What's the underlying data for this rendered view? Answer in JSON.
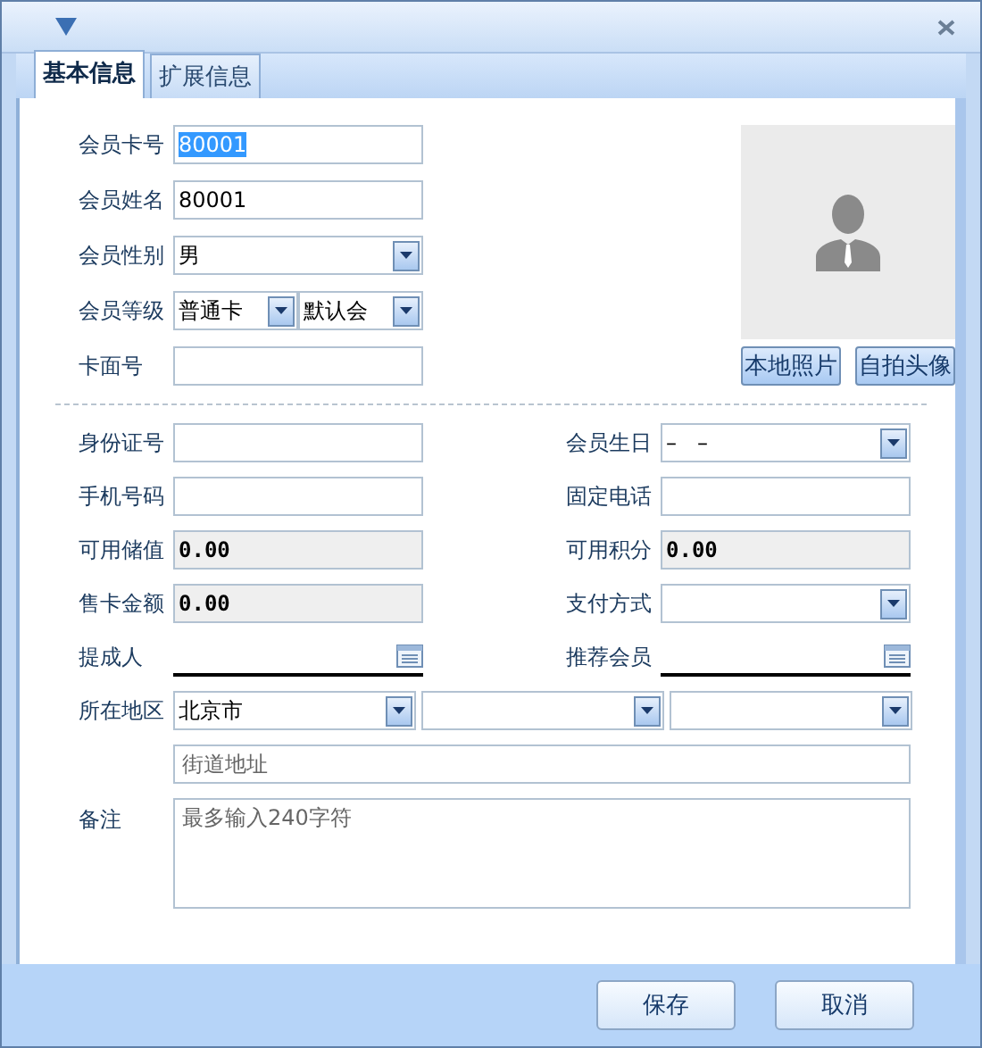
{
  "tabs": [
    {
      "label": "基本信息",
      "selected": true
    },
    {
      "label": "扩展信息",
      "selected": false
    }
  ],
  "top_fields": [
    {
      "label": "会员卡号",
      "kind": "text",
      "value": "80001",
      "highlighted": true
    },
    {
      "label": "会员姓名",
      "kind": "text",
      "value": "80001",
      "highlighted": false
    },
    {
      "label": "会员性别",
      "kind": "combo",
      "value": "男"
    },
    {
      "label": "会员等级",
      "kind": "combo_pair",
      "values": [
        "普通卡",
        "默认会"
      ]
    },
    {
      "label": "卡面号",
      "kind": "text"
    }
  ],
  "photo": {
    "buttons": [
      "本地照片",
      "自拍头像"
    ]
  },
  "details": [
    {
      "left": {
        "label": "身份证号",
        "kind": "text"
      },
      "right": {
        "label": "会员生日",
        "kind": "combo",
        "value": "–   –"
      }
    },
    {
      "left": {
        "label": "手机号码",
        "kind": "text"
      },
      "right": {
        "label": "固定电话",
        "kind": "text"
      }
    },
    {
      "left": {
        "label": "可用储值",
        "kind": "readonly",
        "value": "0.00"
      },
      "right": {
        "label": "可用积分",
        "kind": "readonly",
        "value": "0.00"
      }
    },
    {
      "left": {
        "label": "售卡金额",
        "kind": "readonly",
        "value": "0.00"
      },
      "right": {
        "label": "支付方式",
        "kind": "combo"
      }
    },
    {
      "left": {
        "label": "提成人",
        "kind": "lookup"
      },
      "right": {
        "label": "推荐会员",
        "kind": "lookup"
      }
    }
  ],
  "region": {
    "label": "所在地区",
    "combos": [
      {
        "kind": "filled",
        "value": "北京市"
      },
      {
        "kind": "empty"
      },
      {
        "kind": "empty"
      }
    ],
    "street_placeholder": "街道地址"
  },
  "remark": {
    "label": "备注",
    "placeholder": "最多输入240字符"
  },
  "footer_buttons": [
    "保存",
    "取消"
  ]
}
